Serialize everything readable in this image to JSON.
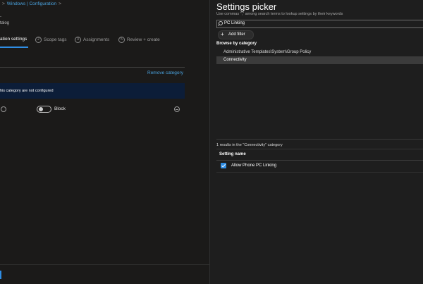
{
  "breadcrumb": {
    "lead_sep": ">",
    "item": "Windows | Configuration",
    "trail_sep": ">"
  },
  "left_header": {
    "subtitle_line1": "-",
    "subtitle_line2": "talog"
  },
  "wizard_steps": [
    {
      "num": "",
      "label": "ation settings",
      "active": true
    },
    {
      "num": "2",
      "label": "Scope tags",
      "active": false
    },
    {
      "num": "3",
      "label": "Assignments",
      "active": false
    },
    {
      "num": "5",
      "label": "Review + create",
      "active": false
    }
  ],
  "category": {
    "remove_label": "Remove category",
    "banner_text": "his category are not configured",
    "setting": {
      "toggle_label": "Block",
      "toggle_on": false
    }
  },
  "picker": {
    "title": "Settings picker",
    "description": "Use commas \",\" among search terms to lookup settings by their keywords",
    "search_value": "PC Linking",
    "add_filter_label": "Add filter",
    "browse_heading": "Browse by category",
    "categories": [
      {
        "label": "Administrative Templates\\System\\Group Policy",
        "selected": false
      },
      {
        "label": "Connectivity",
        "selected": true
      }
    ],
    "results_text": "1 results in the \"Connectivity\" category",
    "table": {
      "column_header": "Setting name",
      "rows": [
        {
          "name": "Allow Phone PC Linking",
          "checked": true
        }
      ]
    }
  },
  "colors": {
    "accent": "#2f8de4",
    "link": "#4aa3df",
    "banner_bg": "#0c1d38",
    "background": "#1b1a19",
    "selected_row": "#3b3b3b"
  },
  "icons": [
    "chevron-right-icon",
    "info-icon",
    "toggle-switch",
    "minus-circle-icon",
    "search-icon",
    "plus-icon",
    "checkbox-checked-icon"
  ]
}
